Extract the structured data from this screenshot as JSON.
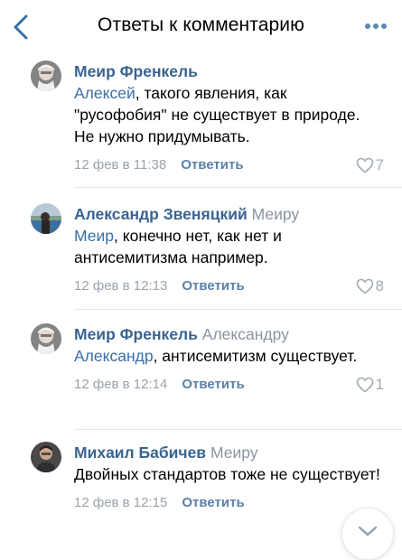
{
  "header": {
    "title": "Ответы к комментарию",
    "back_icon": "chevron-left-icon",
    "more_icon": "more-horizontal-icon"
  },
  "colors": {
    "accent": "#3a6fa8",
    "author": "#3a6491",
    "secondary": "#8a949e"
  },
  "comments": [
    {
      "author": "Меир Френкель",
      "reply_to": "",
      "mention": "Алексей",
      "text": ", такого явления, как \"русофобия\" не существует в природе. Не нужно придумывать.",
      "date": "12 фев в 11:38",
      "reply_label": "Ответить",
      "likes": "7"
    },
    {
      "author": "Александр Звеняцкий",
      "reply_to": "Меиру",
      "mention": "Меир",
      "text": ", конечно нет, как нет и антисемитизма например.",
      "date": "12 фев в 12:13",
      "reply_label": "Ответить",
      "likes": "8"
    },
    {
      "author": "Меир Френкель",
      "reply_to": "Александру",
      "mention": "Александр",
      "text": ", антисемитизм существует.",
      "date": "12 фев в 12:14",
      "reply_label": "Ответить",
      "likes": "1"
    },
    {
      "author": "Михаил Бабичев",
      "reply_to": "Меиру",
      "mention": "",
      "text": "Двойных стандартов тоже не существует!",
      "date": "12 фев в 12:15",
      "reply_label": "Ответить",
      "likes": ""
    }
  ],
  "scroll_button": {
    "icon": "chevron-down-icon"
  }
}
